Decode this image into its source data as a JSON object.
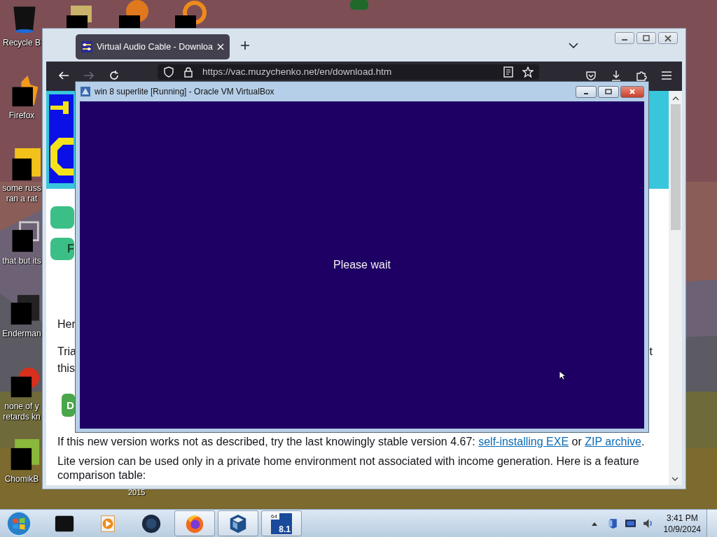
{
  "desktop": {
    "icons": [
      {
        "kind": "bin",
        "label": "Recycle B"
      },
      {
        "kind": "flame",
        "label": "Firefox"
      },
      {
        "kind": "yellow",
        "label": "some russ\nran a rat"
      },
      {
        "kind": "stack",
        "label": "that but its"
      },
      {
        "kind": "doc",
        "label": "Enderman"
      },
      {
        "kind": "red",
        "label": "none of y\nretards kn"
      },
      {
        "kind": "hamster",
        "label": "ChomikB"
      }
    ],
    "top_icons": [
      {
        "kind": "folder"
      },
      {
        "kind": "orange"
      },
      {
        "kind": "ring"
      }
    ],
    "caption": "2015"
  },
  "browser": {
    "tabs": [
      {
        "title": "Virtual Audio Cable - Downloa",
        "selected": true
      }
    ],
    "nav": [
      {
        "kind": "back",
        "disabled": false
      },
      {
        "kind": "forward",
        "disabled": true
      },
      {
        "kind": "reload",
        "disabled": false
      }
    ],
    "url": "https://vac.muzychenko.net/en/download.htm",
    "page": {
      "blocks": [
        {
          "kind": "nav_button"
        },
        {
          "kind": "nav_button",
          "label": "F"
        },
        {
          "kind": "text",
          "text": "Her"
        },
        {
          "kind": "split",
          "left": "Tria",
          "right": "t"
        },
        {
          "kind": "text",
          "text": "this"
        },
        {
          "kind": "download_button",
          "label": "D"
        },
        {
          "kind": "paragraph",
          "parts": [
            {
              "text": "If this new version works not as described, try the last knowingly stable version 4.67: ",
              "link": false
            },
            {
              "text": "self-installing EXE",
              "link": true
            },
            {
              "text": " or ",
              "link": false
            },
            {
              "text": "ZIP archive",
              "link": true
            },
            {
              "text": ".",
              "link": false
            }
          ]
        },
        {
          "kind": "paragraph",
          "parts": [
            {
              "text": "Lite version can be used only in a private home environment not associated with income generation. Here is a feature comparison table:",
              "link": false
            }
          ]
        }
      ]
    }
  },
  "vm_window": {
    "title": "win 8 superlite [Running] - Oracle VM VirtualBox",
    "message": "Please wait"
  },
  "taskbar": {
    "apps": [
      {
        "kind": "black",
        "selected": false
      },
      {
        "kind": "media",
        "selected": false
      },
      {
        "kind": "globe",
        "selected": false
      },
      {
        "kind": "firefox",
        "selected": true
      },
      {
        "kind": "vbox",
        "selected": true
      },
      {
        "kind": "win8",
        "selected": true,
        "badge": "64",
        "label": "8.1"
      }
    ],
    "time": "3:41 PM",
    "date": "10/9/2024"
  }
}
